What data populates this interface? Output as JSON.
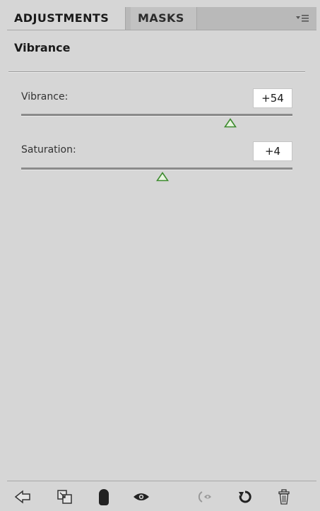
{
  "tabs": [
    {
      "label": "ADJUSTMENTS",
      "active": true
    },
    {
      "label": "MASKS",
      "active": false
    }
  ],
  "panel_menu_icon": "panel-menu-icon",
  "adjustment": {
    "title": "Vibrance"
  },
  "sliders": [
    {
      "label": "Vibrance:",
      "value": "+54",
      "level": 54,
      "range": [
        -100,
        100
      ]
    },
    {
      "label": "Saturation:",
      "value": "+4",
      "level": 4,
      "range": [
        -100,
        100
      ]
    }
  ],
  "toolbar_icons": [
    "back-arrow-icon",
    "clip-to-layer-icon",
    "mask-icon",
    "eye-visibility-icon",
    "previous-state-icon",
    "reset-icon",
    "trash-icon"
  ],
  "colors": {
    "panel_bg": "#d6d6d6",
    "thumb_fill": "#e8f5e0",
    "thumb_stroke": "#3c8a2e"
  }
}
